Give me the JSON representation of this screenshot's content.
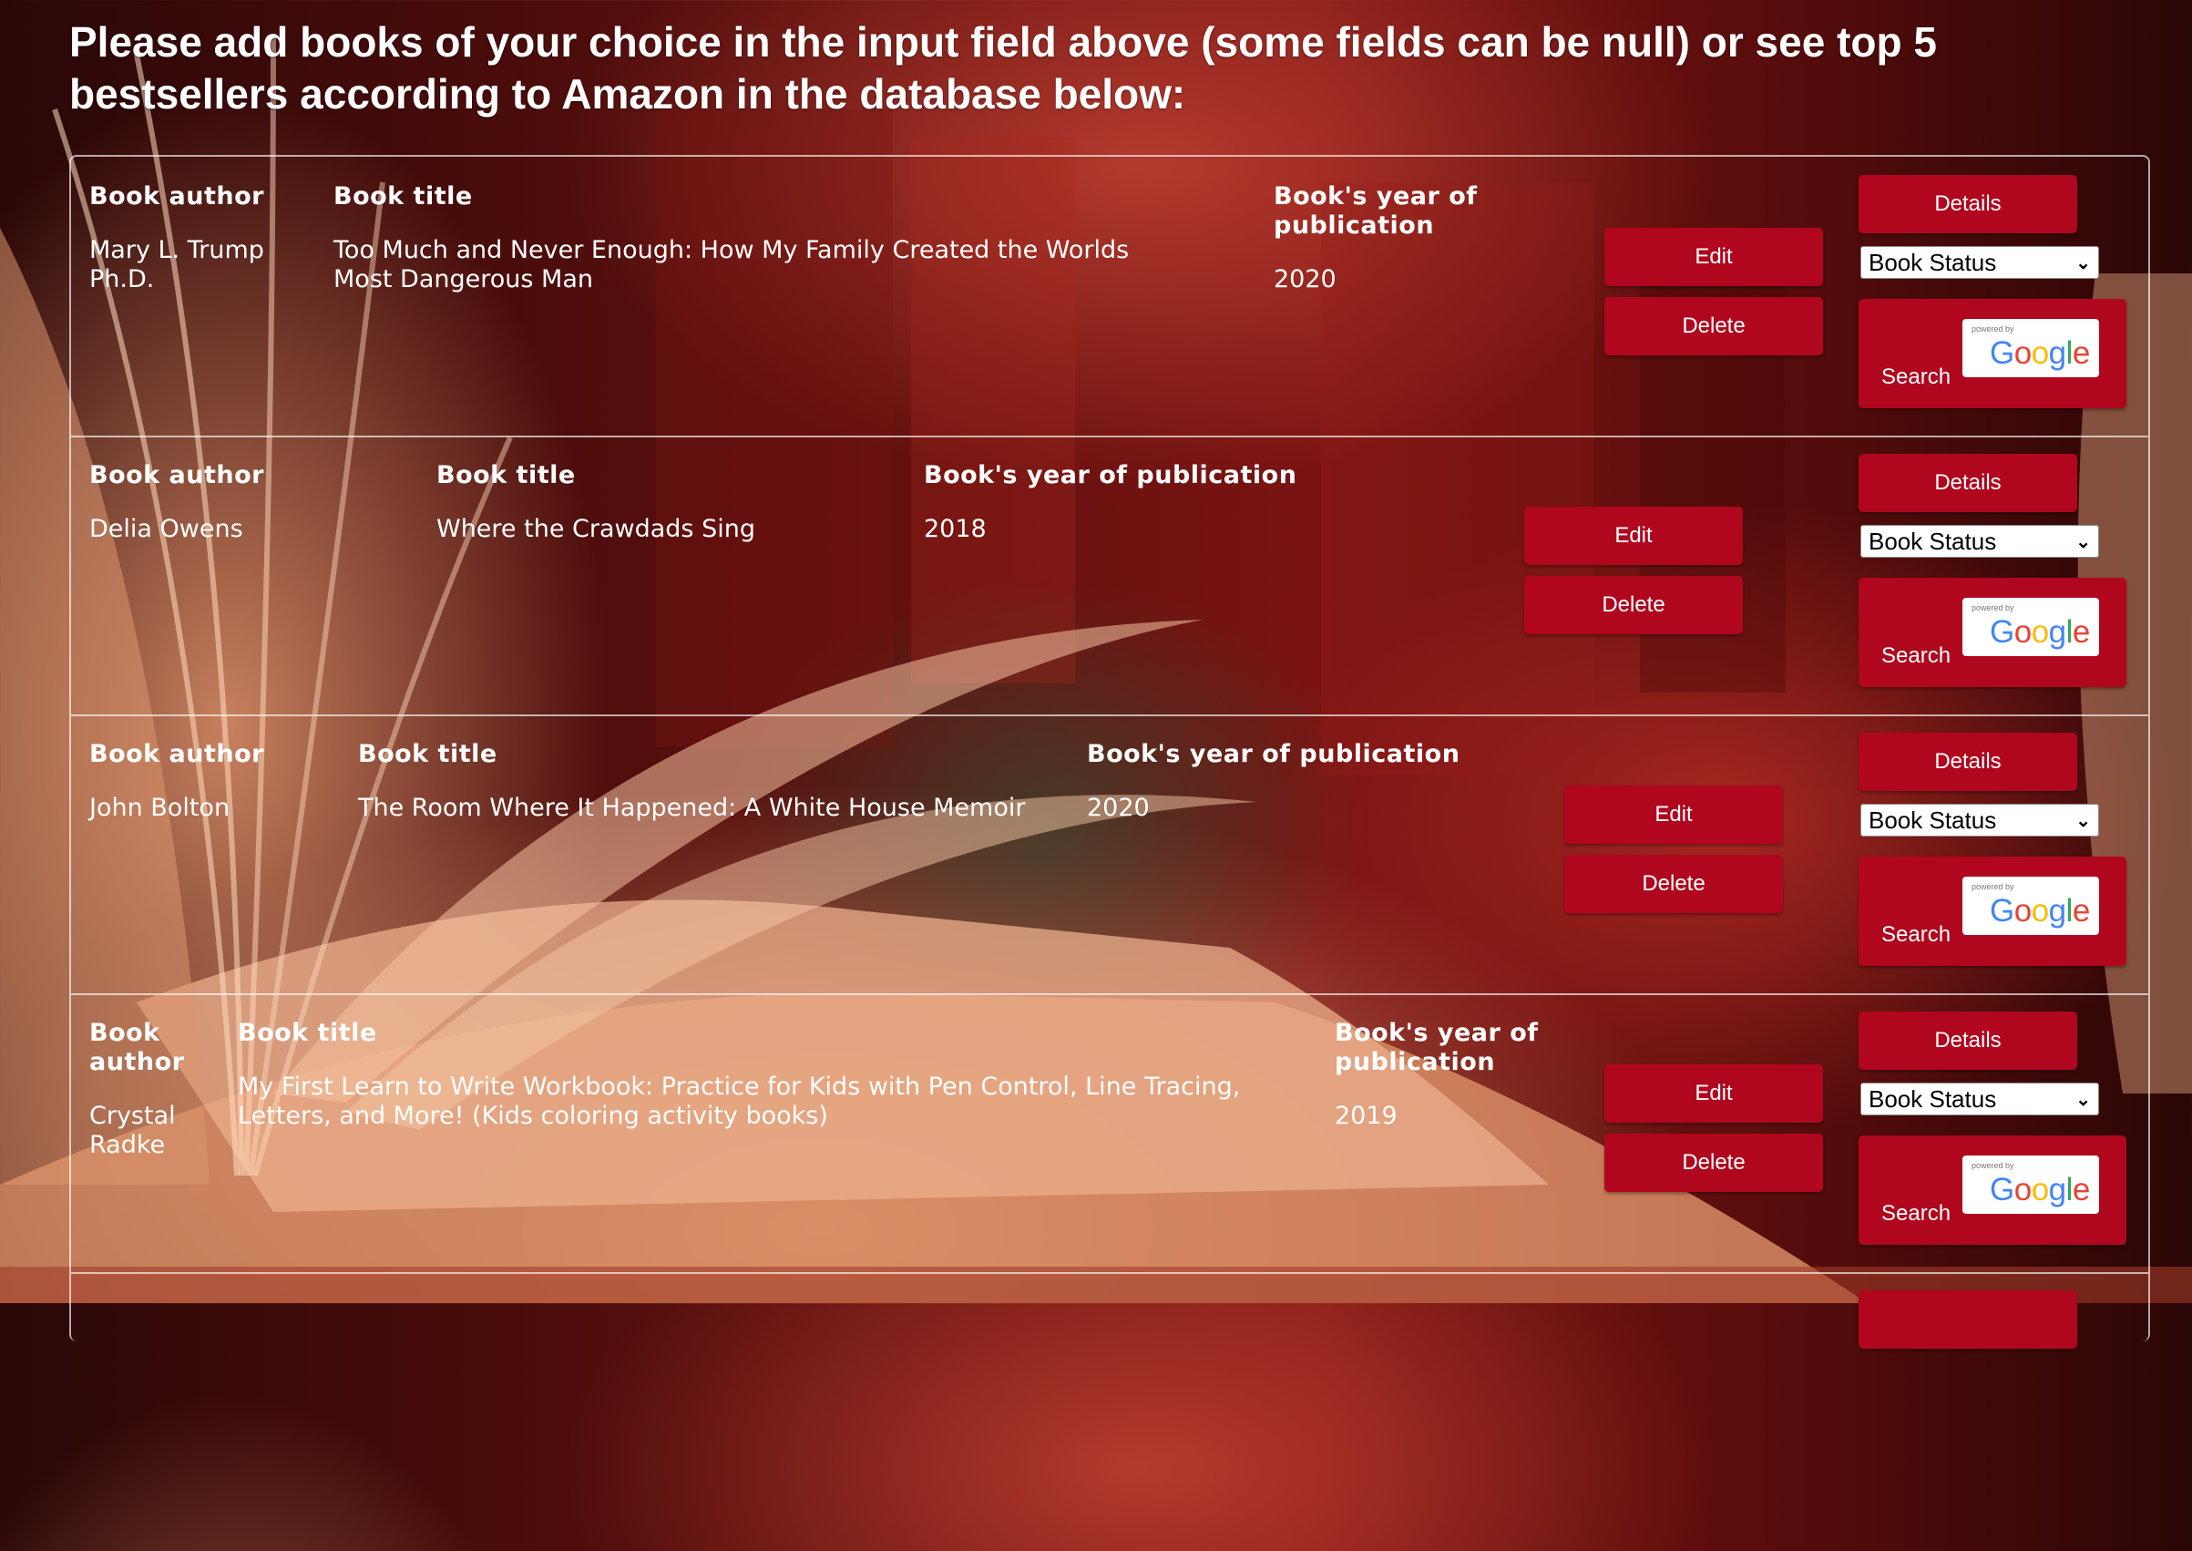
{
  "intro_text": "Please add books of your choice in the input field above (some fields can be null) or see top 5 bestsellers according to Amazon in the database below:",
  "column_headers": {
    "author": "Book author",
    "title": "Book title",
    "year": "Book's year of publication"
  },
  "buttons": {
    "details": "Details",
    "edit": "Edit",
    "delete": "Delete",
    "search": "Search",
    "status_select": "Book Status"
  },
  "google_badge": {
    "powered_by": "powered by",
    "letters": [
      "G",
      "o",
      "o",
      "g",
      "l",
      "e"
    ],
    "letter_colors": [
      "#4285F4",
      "#EA4335",
      "#FBBC05",
      "#4285F4",
      "#34A853",
      "#EA4335"
    ]
  },
  "colors": {
    "button_red": "#b0071e",
    "border": "#ffffff"
  },
  "books": [
    {
      "author": "Mary L. Trump Ph.D.",
      "title": "Too Much and Never Enough: How My Family Created the Worlds Most Dangerous Man",
      "year": "2020"
    },
    {
      "author": "Delia Owens",
      "title": "Where the Crawdads Sing",
      "year": "2018"
    },
    {
      "author": "John Bolton",
      "title": "The Room Where It Happened: A White House Memoir",
      "year": "2020"
    },
    {
      "author": "Crystal Radke",
      "title": "My First Learn to Write Workbook: Practice for Kids with Pen Control, Line Tracing, Letters, and More! (Kids coloring activity books)",
      "year": "2019"
    }
  ]
}
